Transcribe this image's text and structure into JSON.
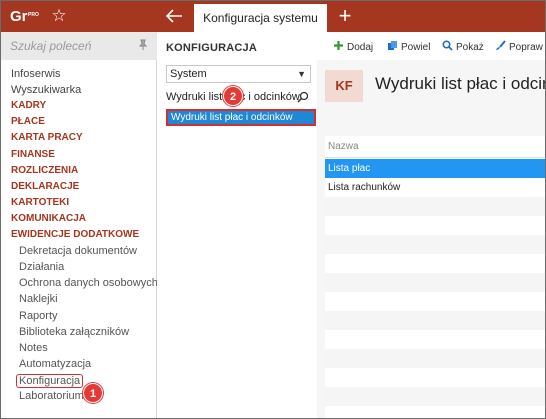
{
  "app": {
    "logo_text": "Gr",
    "logo_badge": "PRO",
    "tab_label": "Konfiguracja systemu"
  },
  "sidebar": {
    "search_placeholder": "Szukaj poleceń",
    "items": [
      {
        "label": "Infoserwis",
        "kind": "plain"
      },
      {
        "label": "Wyszukiwarka",
        "kind": "plain"
      },
      {
        "label": "KADRY",
        "kind": "cat"
      },
      {
        "label": "PŁACE",
        "kind": "cat"
      },
      {
        "label": "KARTA PRACY",
        "kind": "cat"
      },
      {
        "label": "FINANSE",
        "kind": "cat"
      },
      {
        "label": "ROZLICZENIA",
        "kind": "cat"
      },
      {
        "label": "DEKLARACJE",
        "kind": "cat"
      },
      {
        "label": "KARTOTEKI",
        "kind": "cat"
      },
      {
        "label": "KOMUNIKACJA",
        "kind": "cat"
      },
      {
        "label": "EWIDENCJE DODATKOWE",
        "kind": "cat"
      },
      {
        "label": "Dekretacja dokumentów",
        "kind": "sub"
      },
      {
        "label": "Działania",
        "kind": "sub"
      },
      {
        "label": "Ochrona danych osobowych",
        "kind": "sub"
      },
      {
        "label": "Naklejki",
        "kind": "sub"
      },
      {
        "label": "Raporty",
        "kind": "sub"
      },
      {
        "label": "Biblioteka załączników",
        "kind": "sub"
      },
      {
        "label": "Notes",
        "kind": "sub"
      },
      {
        "label": "Automatyzacja",
        "kind": "sub"
      },
      {
        "label": "Konfiguracja",
        "kind": "sub-active"
      },
      {
        "label": "Laboratorium",
        "kind": "sub"
      }
    ]
  },
  "middle": {
    "title": "KONFIGURACJA",
    "select_value": "System",
    "filter_value": "Wydruki list płac i odcinków",
    "result_label": "Wydruki list płac i odcinków"
  },
  "right": {
    "toolbar": {
      "add": "Dodaj",
      "duplicate": "Powiel",
      "show": "Pokaż",
      "edit": "Popraw"
    },
    "badge": "KF",
    "title": "Wydruki list płac i odcinków",
    "table": {
      "header": "Nazwa",
      "rows": [
        "Lista płac",
        "Lista rachunków"
      ]
    }
  },
  "callouts": {
    "first": "1",
    "second": "2"
  },
  "colors": {
    "brand": "#a5361f",
    "selection": "#2196f3",
    "callout": "#e53935"
  }
}
